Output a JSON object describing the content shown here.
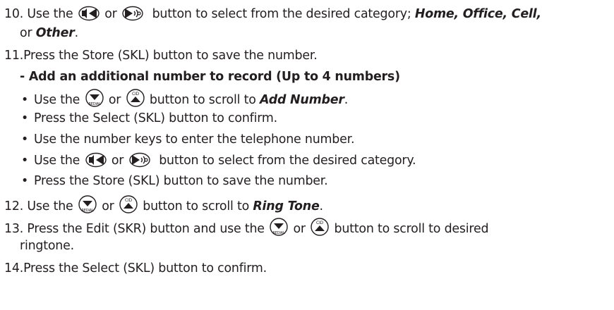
{
  "steps": {
    "s10": {
      "num": "10.",
      "t1": "Use the",
      "t2": "or",
      "t3": "button to select from the desired category;",
      "c1": "Home, Office, Cell,",
      "t4": "or",
      "c2": "Other",
      "t5": "."
    },
    "s11": {
      "num": "11.",
      "text": "Press the Store (SKL) button to save the number."
    },
    "sub": {
      "heading": "- Add an additional number to record (Up to 4 numbers)",
      "b1": {
        "t1": "Use the",
        "t2": "or",
        "t3": "button to scroll to",
        "em": "Add Number",
        "t4": "."
      },
      "b2": "Press the Select (SKL) button to confirm.",
      "b3": "Use the number keys to enter the telephone number.",
      "b4": {
        "t1": "Use the",
        "t2": "or",
        "t3": "button to select from the desired category."
      },
      "b5": "Press the Store (SKL) button to save the number."
    },
    "s12": {
      "num": "12.",
      "t1": "Use the",
      "t2": "or",
      "t3": "button to scroll to",
      "em": "Ring Tone",
      "t4": "."
    },
    "s13": {
      "num": "13.",
      "t1": "Press the Edit (SKR) button and use the",
      "t2": "or",
      "t3": "button to scroll to desired",
      "cont": "ringtone."
    },
    "s14": {
      "num": "14.",
      "text": "Press the Select (SKL) button to confirm."
    }
  },
  "icons": {
    "left": "left-arrow-mute-icon",
    "right": "right-arrow-voice-icon",
    "down": "down-arrow-redial-icon",
    "up": "up-arrow-cid-icon"
  },
  "bullet": "•"
}
